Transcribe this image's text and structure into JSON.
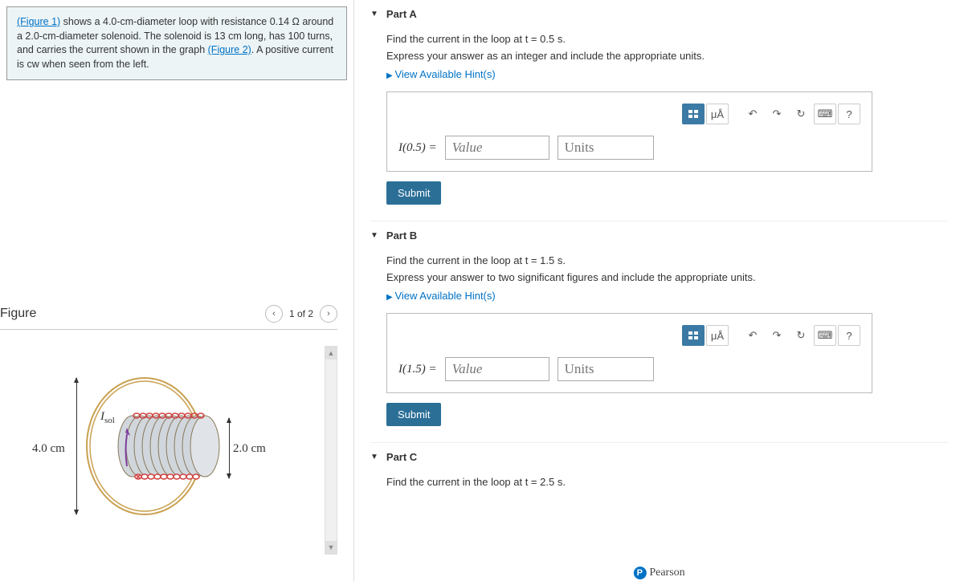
{
  "intro": {
    "fig1_link": "(Figure 1)",
    "text1": " shows a 4.0-cm-diameter loop with resistance 0.14 Ω around a 2.0-cm-diameter solenoid. The solenoid is 13 cm long, has 100 turns, and carries the current shown in the graph ",
    "fig2_link": "(Figure 2)",
    "text2": ". A positive current is cw when seen from the left."
  },
  "figure": {
    "heading": "Figure",
    "nav_label": "1 of 2",
    "label_4cm": "4.0 cm",
    "label_2cm": "2.0 cm",
    "label_isol": "I",
    "label_isol_sub": "sol"
  },
  "parts": {
    "a": {
      "title": "Part A",
      "prompt": "Find the current in the loop at t = 0.5 s.",
      "instruction": "Express your answer as an integer and include the appropriate units.",
      "hints": "View Available Hint(s)",
      "label": "I(0.5) =",
      "value_ph": "Value",
      "units_ph": "Units",
      "submit": "Submit"
    },
    "b": {
      "title": "Part B",
      "prompt": "Find the current in the loop at t = 1.5 s.",
      "instruction": "Express your answer to two significant figures and include the appropriate units.",
      "hints": "View Available Hint(s)",
      "label": "I(1.5) =",
      "value_ph": "Value",
      "units_ph": "Units",
      "submit": "Submit"
    },
    "c": {
      "title": "Part C",
      "prompt": "Find the current in the loop at t = 2.5 s."
    }
  },
  "toolbar": {
    "units_toggle": "μÅ",
    "help": "?"
  },
  "footer": {
    "brand": "Pearson"
  }
}
